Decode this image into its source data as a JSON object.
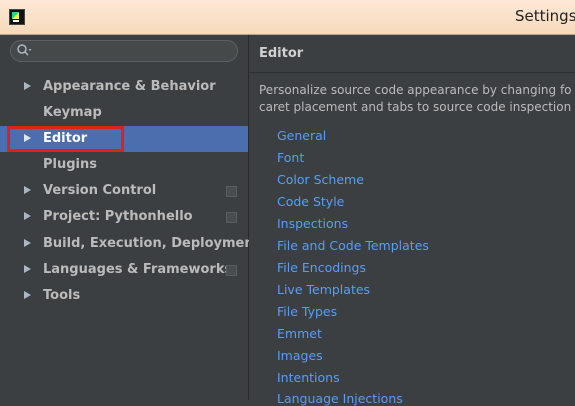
{
  "window": {
    "title": "Settings"
  },
  "search": {
    "placeholder": ""
  },
  "sidebar": {
    "items": [
      {
        "label": "Appearance & Behavior"
      },
      {
        "label": "Keymap"
      },
      {
        "label": "Editor"
      },
      {
        "label": "Plugins"
      },
      {
        "label": "Version Control"
      },
      {
        "label": "Project: Pythonhello"
      },
      {
        "label": "Build, Execution, Deployment"
      },
      {
        "label": "Languages & Frameworks"
      },
      {
        "label": "Tools"
      }
    ],
    "selected": "Editor"
  },
  "panel": {
    "title": "Editor",
    "description_line1": "Personalize source code appearance by changing fo",
    "description_line2": "caret placement and tabs to source code inspection",
    "links": [
      "General",
      "Font",
      "Color Scheme",
      "Code Style",
      "Inspections",
      "File and Code Templates",
      "File Encodings",
      "Live Templates",
      "File Types",
      "Emmet",
      "Images",
      "Intentions",
      "Language Injections"
    ]
  },
  "colors": {
    "selection": "#4b6eaf",
    "link": "#589df6",
    "highlight_box": "#e0201b",
    "background": "#3c3f41"
  }
}
